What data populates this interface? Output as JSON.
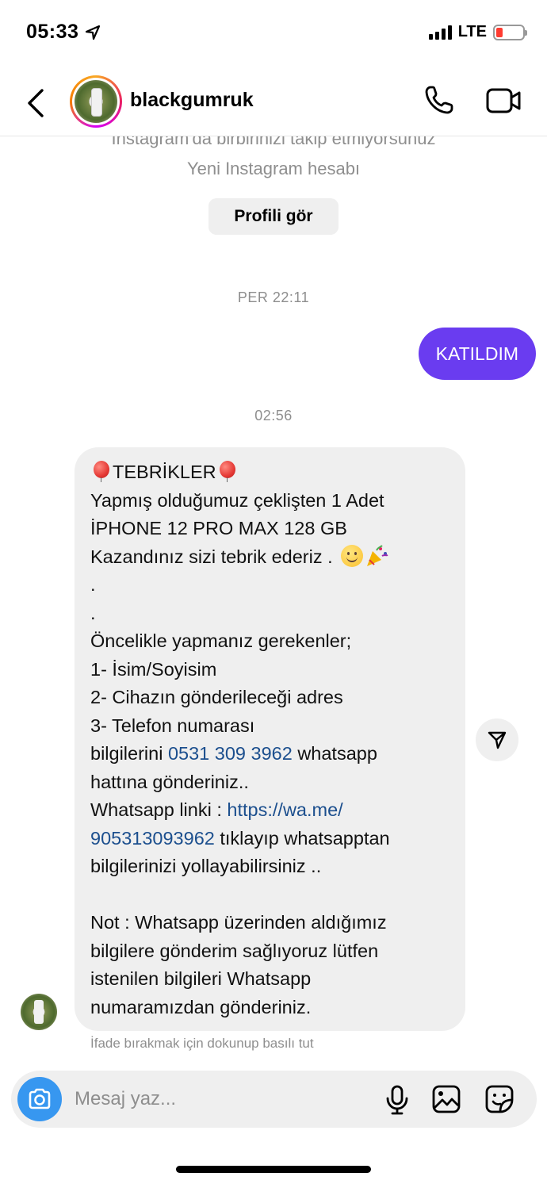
{
  "status_bar": {
    "time": "05:33",
    "network": "LTE",
    "battery_color": "#ff3b30"
  },
  "header": {
    "username": "blackgumruk",
    "icons": [
      "back-icon",
      "phone-icon",
      "video-icon"
    ]
  },
  "profile_info": {
    "follow_text": "Instagram'da birbirinizi takip etmiyorsunuz",
    "account_text": "Yeni Instagram hesabı",
    "view_profile_label": "Profili gör"
  },
  "messages": {
    "timestamp_1": "PER 22:11",
    "sent_text": "KATILDIM",
    "sent_color": "#6a3cf0",
    "timestamp_2": "02:56",
    "received": {
      "line_1": "TEBRİKLER",
      "line_2": "Yapmış olduğumuz çeklişten 1 Adet",
      "line_3": "İPHONE 12 PRO MAX 128 GB",
      "line_4": "Kazandınız sizi tebrik ederiz .",
      "line_5": ".",
      "line_6": ".",
      "line_7": "Öncelikle yapmanız gerekenler;",
      "line_8": "1- İsim/Soyisim",
      "line_9": "2- Cihazın gönderileceği adres",
      "line_10": "3- Telefon numarası",
      "line_11_pre": "bilgilerini ",
      "line_11_link": "0531 309 3962",
      "line_11_post": " whatsapp",
      "line_12": "hattına gönderiniz..",
      "line_13_pre": "Whatsapp linki : ",
      "line_13_link": "https://wa.me/",
      "line_14_link": "905313093962",
      "line_14_post": " tıklayıp whatsapptan",
      "line_15": "bilgilerinizi yollayabilirsiniz ..",
      "line_17": "Not : Whatsapp üzerinden aldığımız",
      "line_18": "bilgilere gönderim sağlıyoruz lütfen",
      "line_19": "istenilen bilgileri Whatsapp",
      "line_20": "numaramızdan gönderiniz.",
      "link_color": "#1c4f8e"
    },
    "hint": "İfade bırakmak için dokunup basılı tut"
  },
  "composer": {
    "placeholder": "Mesaj yaz...",
    "camera_color": "#3797f0",
    "icons": [
      "camera-icon",
      "microphone-icon",
      "gallery-icon",
      "sticker-icon"
    ]
  }
}
